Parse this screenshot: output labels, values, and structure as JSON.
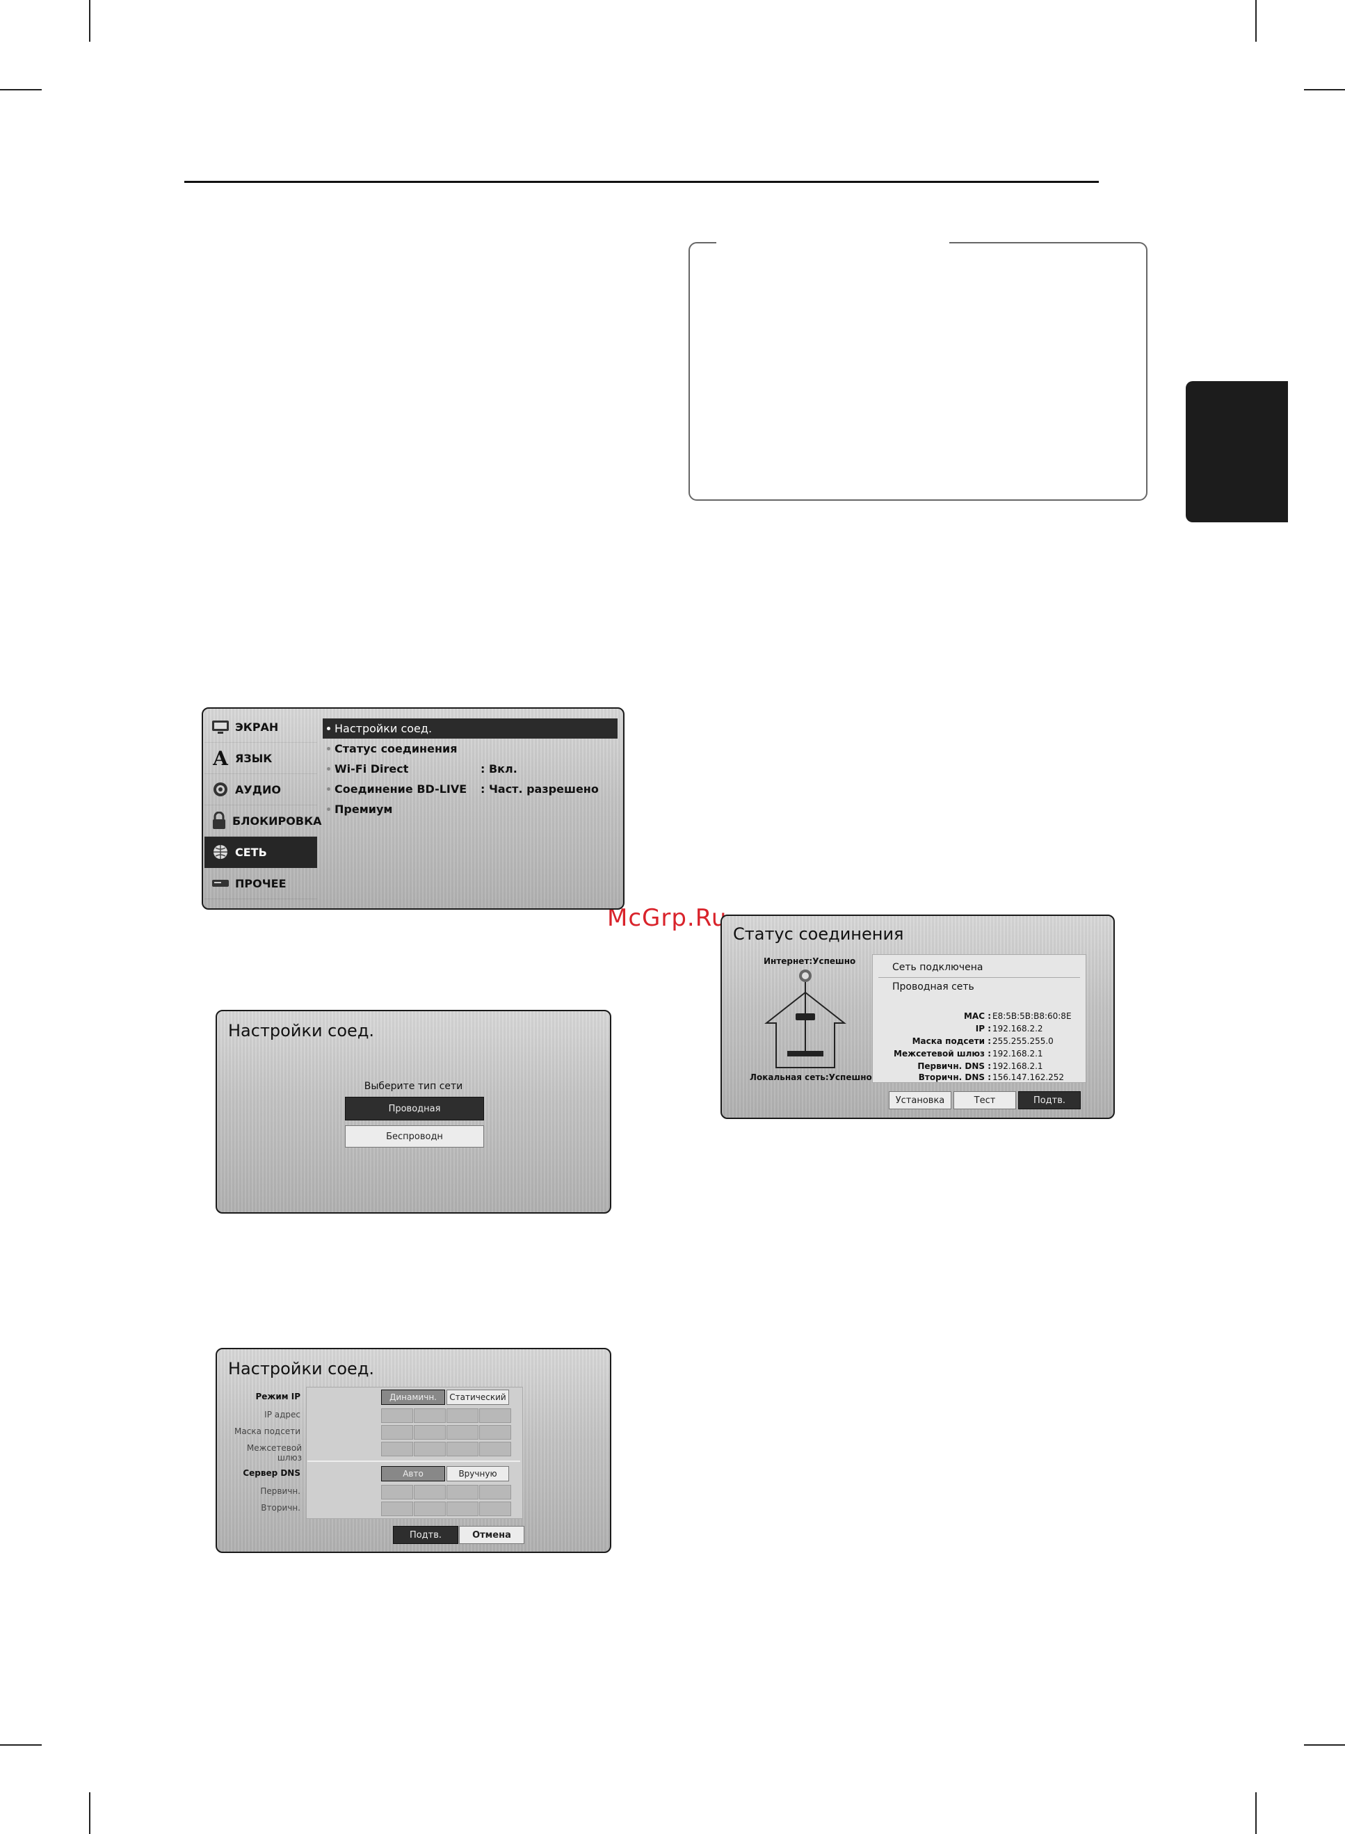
{
  "watermark": "McGrp.Ru",
  "setup_menu": {
    "categories": [
      "ЭКРАН",
      "ЯЗЫК",
      "АУДИО",
      "БЛОКИРОВКА",
      "СЕТЬ",
      "ПРОЧЕЕ"
    ],
    "selected_category": "СЕТЬ",
    "options": [
      {
        "label": "Настройки соед.",
        "value": ""
      },
      {
        "label": "Статус соединения",
        "value": ""
      },
      {
        "label": "Wi-Fi Direct",
        "value": ": Вкл."
      },
      {
        "label": "Соединение BD-LIVE",
        "value": ": Част. разрешено"
      },
      {
        "label": "Премиум",
        "value": ""
      }
    ]
  },
  "network_type_dialog": {
    "title": "Настройки соед.",
    "prompt": "Выберите тип сети",
    "wired": "Проводная",
    "wireless": "Беспроводн"
  },
  "ip_dialog": {
    "title": "Настройки соед.",
    "ip_mode_label": "Режим IP",
    "ip_mode_dynamic": "Динамичн.",
    "ip_mode_static": "Статический",
    "ip_address_label": "IP адрес",
    "subnet_label": "Маска подсети",
    "gateway_label": "Межсетевой шлюз",
    "dns_label": "Сервер DNS",
    "dns_auto": "Авто",
    "dns_manual": "Вручную",
    "primary_label": "Первичн.",
    "secondary_label": "Вторичн.",
    "ok": "Подтв.",
    "cancel": "Отмена"
  },
  "status_dialog": {
    "title": "Статус соединения",
    "internet_status": "Интернет:Успешно",
    "local_status": "Локальная сеть:Успешно",
    "connected": "Сеть подключена",
    "network_type": "Проводная сеть",
    "fields": [
      {
        "key": "MAC :",
        "value": "E8:5B:5B:B8:60:8E"
      },
      {
        "key": "IP :",
        "value": "192.168.2.2"
      },
      {
        "key": "Маска подсети :",
        "value": "255.255.255.0"
      },
      {
        "key": "Межсетевой шлюз :",
        "value": "192.168.2.1"
      },
      {
        "key": "Первичн. DNS :",
        "value": "192.168.2.1"
      },
      {
        "key": "Вторичн. DNS :",
        "value": "156.147.162.252"
      }
    ],
    "btn_setup": "Установка",
    "btn_test": "Тест",
    "btn_ok": "Подтв."
  }
}
